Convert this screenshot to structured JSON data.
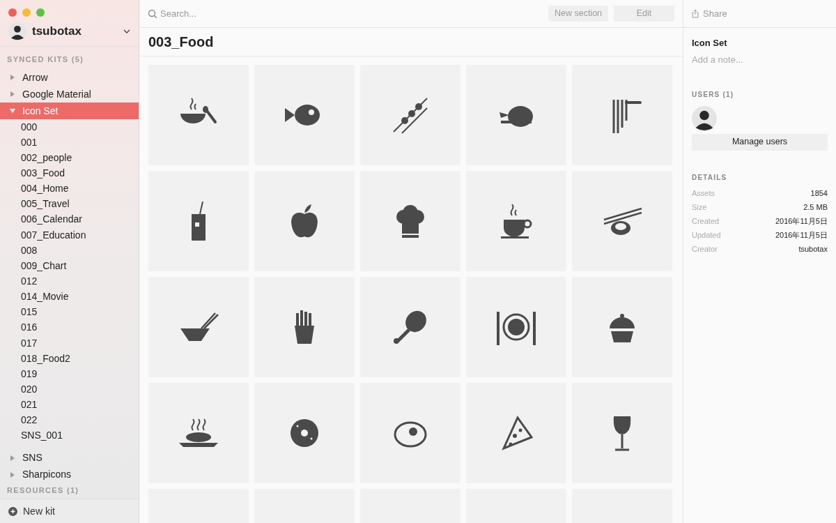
{
  "account": {
    "name": "tsubotax"
  },
  "sidebar": {
    "sections": [
      {
        "title": "SYNCED KITS (5)",
        "kits": [
          {
            "label": "Arrow",
            "expanded": false,
            "selected": false
          },
          {
            "label": "Google Material",
            "expanded": false,
            "selected": false
          },
          {
            "label": "Icon Set",
            "expanded": true,
            "selected": true,
            "children": [
              {
                "label": "000"
              },
              {
                "label": "001"
              },
              {
                "label": "002_people"
              },
              {
                "label": "003_Food"
              },
              {
                "label": "004_Home"
              },
              {
                "label": "005_Travel"
              },
              {
                "label": "006_Calendar"
              },
              {
                "label": "007_Education"
              },
              {
                "label": "008"
              },
              {
                "label": "009_Chart"
              },
              {
                "label": "012"
              },
              {
                "label": "014_Movie"
              },
              {
                "label": "015"
              },
              {
                "label": "016"
              },
              {
                "label": "017"
              },
              {
                "label": "018_Food2"
              },
              {
                "label": "019"
              },
              {
                "label": "020"
              },
              {
                "label": "021"
              },
              {
                "label": "022"
              },
              {
                "label": "SNS_001"
              }
            ]
          },
          {
            "label": "SNS",
            "expanded": false,
            "selected": false
          },
          {
            "label": "Sharpicons",
            "expanded": false,
            "selected": false
          }
        ]
      },
      {
        "title": "RESOURCES (1)"
      }
    ],
    "footer_button": "New kit"
  },
  "toolbar": {
    "search_placeholder": "Search...",
    "buttons": [
      "New section",
      "Edit"
    ]
  },
  "section_title": "003_Food",
  "assets": [
    {
      "kind": "soup"
    },
    {
      "kind": "fish"
    },
    {
      "kind": "skewer"
    },
    {
      "kind": "roast"
    },
    {
      "kind": "noodles"
    },
    {
      "kind": "drink"
    },
    {
      "kind": "apple"
    },
    {
      "kind": "chef"
    },
    {
      "kind": "coffee"
    },
    {
      "kind": "sushi"
    },
    {
      "kind": "bowl"
    },
    {
      "kind": "fries"
    },
    {
      "kind": "drumstick"
    },
    {
      "kind": "plate"
    },
    {
      "kind": "cupcake"
    },
    {
      "kind": "pasta"
    },
    {
      "kind": "donut"
    },
    {
      "kind": "egg"
    },
    {
      "kind": "pizza"
    },
    {
      "kind": "wine"
    },
    {
      "kind": "partial"
    },
    {
      "kind": "partial"
    },
    {
      "kind": "partial"
    },
    {
      "kind": "partial"
    },
    {
      "kind": "partial"
    }
  ],
  "inspector": {
    "share": "Share",
    "title": "Icon Set",
    "note_placeholder": "Add a note...",
    "users_title": "USERS (1)",
    "manage_button": "Manage users",
    "details_title": "DETAILS",
    "details": [
      {
        "label": "Assets",
        "value": "1854"
      },
      {
        "label": "Size",
        "value": "2.5 MB"
      },
      {
        "label": "Created",
        "value": "2016年11月5日"
      },
      {
        "label": "Updated",
        "value": "2016年11月5日"
      },
      {
        "label": "Creator",
        "value": "tsubotax"
      }
    ]
  }
}
